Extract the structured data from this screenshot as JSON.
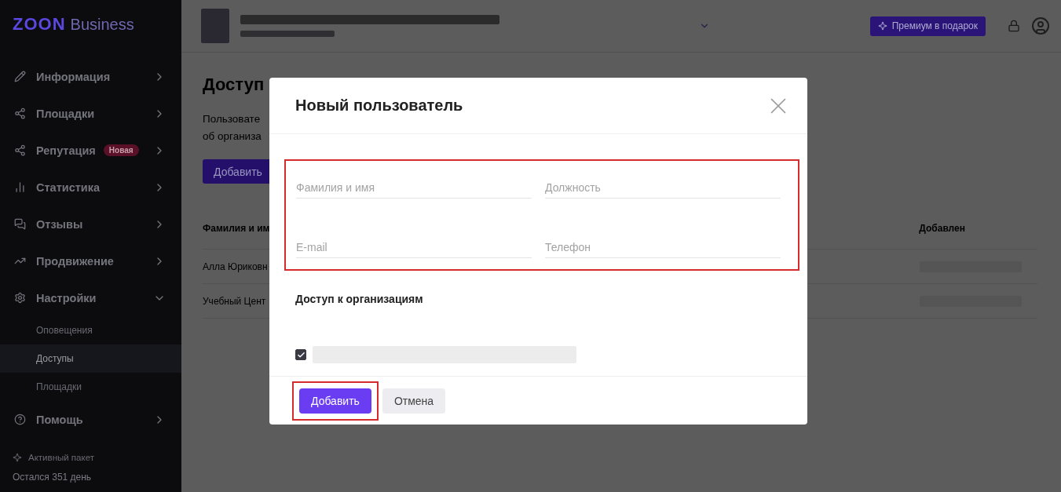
{
  "sidebar": {
    "logo": {
      "brand": "ZOON",
      "suffix": "Business"
    },
    "items": [
      {
        "label": "Информация",
        "expanded": false
      },
      {
        "label": "Площадки",
        "expanded": false
      },
      {
        "label": "Репутация",
        "badge": "Новая",
        "expanded": false
      },
      {
        "label": "Статистика",
        "expanded": false
      },
      {
        "label": "Отзывы",
        "expanded": false
      },
      {
        "label": "Продвижение",
        "expanded": false
      },
      {
        "label": "Настройки",
        "expanded": true,
        "children": [
          {
            "label": "Оповещения",
            "selected": false
          },
          {
            "label": "Доступы",
            "selected": true
          },
          {
            "label": "Площадки",
            "selected": false
          }
        ]
      },
      {
        "label": "Помощь",
        "expanded": false
      }
    ],
    "package": {
      "label": "Активный пакет",
      "remaining": "Остался 351 день"
    }
  },
  "header": {
    "premium_button": "Премиум в подарок"
  },
  "page": {
    "title": "Доступ",
    "description": [
      "Пользовате",
      "об организа"
    ],
    "add_button": "Добавить",
    "table": {
      "columns": [
        "Фамилия и им",
        "Добавлен"
      ],
      "rows": [
        [
          "Алла Юриковн"
        ],
        [
          "Учебный Цент"
        ]
      ]
    }
  },
  "dialog": {
    "title": "Новый пользователь",
    "fields": [
      {
        "placeholder": "Фамилия и имя"
      },
      {
        "placeholder": "Должность"
      },
      {
        "placeholder": "E-mail"
      },
      {
        "placeholder": "Телефон"
      }
    ],
    "section_title": "Доступ к организациям",
    "organizations": [
      {
        "checked": true
      }
    ],
    "buttons": [
      {
        "label": "Добавить",
        "kind": "primary"
      },
      {
        "label": "Отмена",
        "kind": "secondary"
      }
    ]
  }
}
